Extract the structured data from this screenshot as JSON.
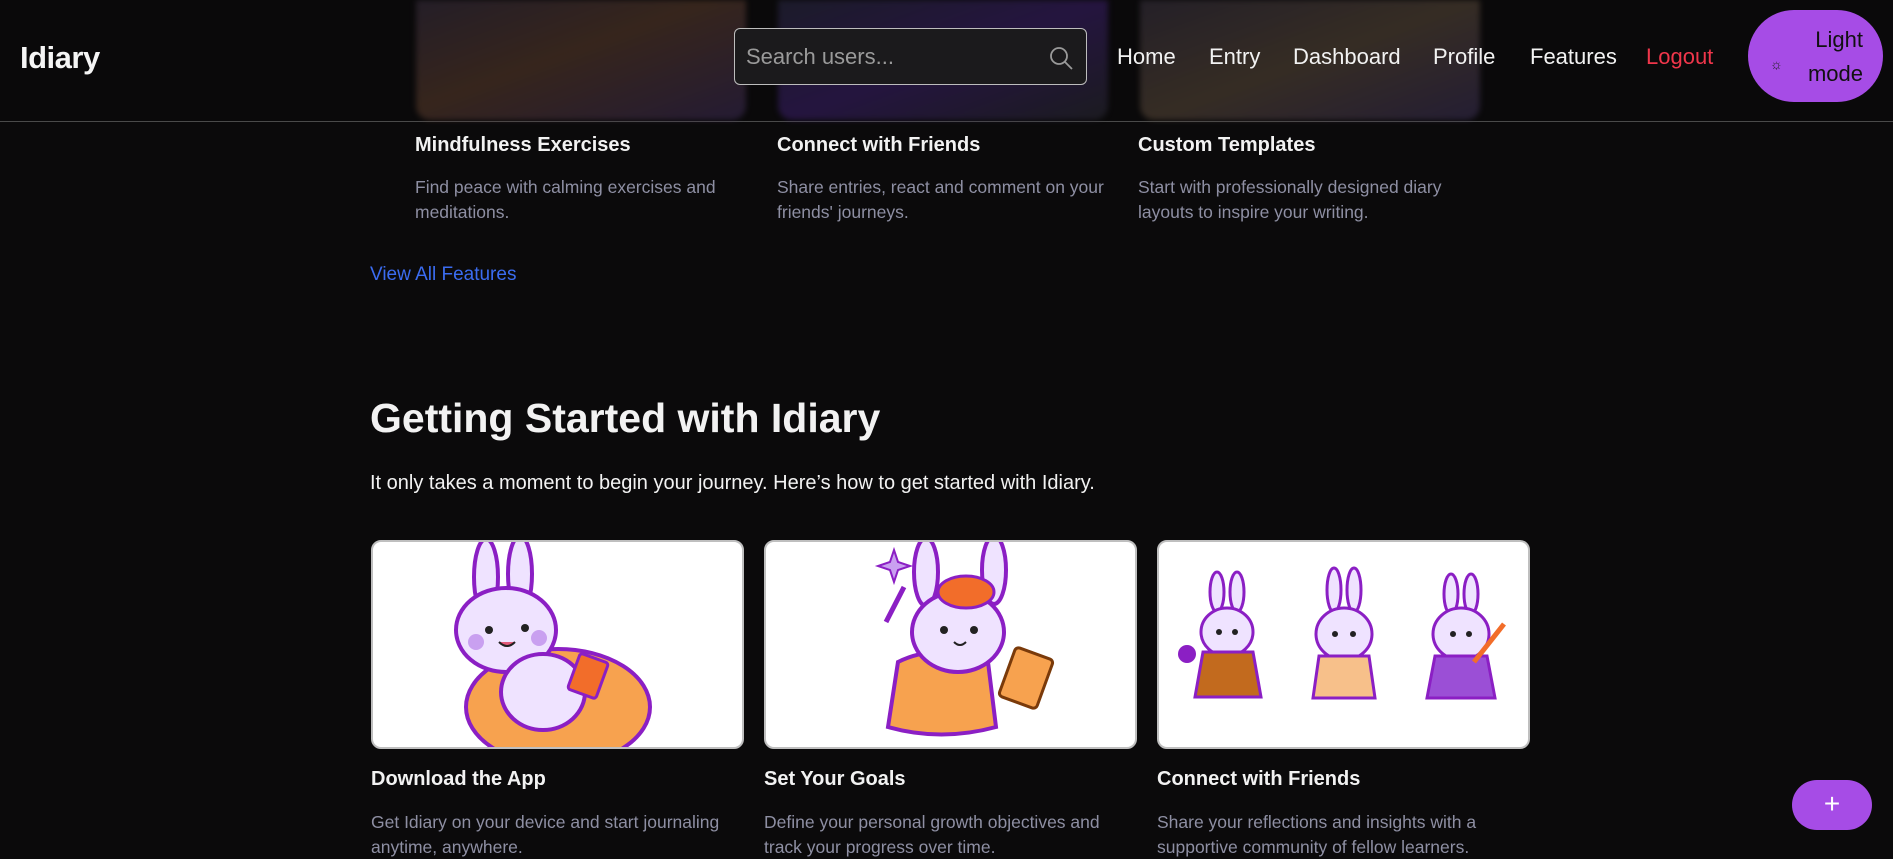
{
  "header": {
    "brand": "Idiary",
    "search_placeholder": "Search users...",
    "nav": [
      "Home",
      "Entry",
      "Dashboard",
      "Profile",
      "Features"
    ],
    "logout": "Logout",
    "mode_button": {
      "line1": "Light",
      "line2": "mode"
    }
  },
  "features": [
    {
      "title": "Mindfulness Exercises",
      "desc": "Find peace with calming exercises and meditations."
    },
    {
      "title": "Connect with Friends",
      "desc": "Share entries, react and comment on your friends' journeys."
    },
    {
      "title": "Custom Templates",
      "desc": "Start with professionally designed diary layouts to inspire your writing."
    }
  ],
  "view_all": "View All Features",
  "getting_started": {
    "heading": "Getting Started with Idiary",
    "lead": "It only takes a moment to begin your journey. Here’s how to get started with Idiary.",
    "steps": [
      {
        "title": "Download the App",
        "desc": "Get Idiary on your device and start journaling anytime, anywhere."
      },
      {
        "title": "Set Your Goals",
        "desc": "Define your personal growth objectives and track your progress over time."
      },
      {
        "title": "Connect with Friends",
        "desc": "Share your reflections and insights with a supportive community of fellow learners."
      }
    ]
  },
  "fab": "+",
  "colors": {
    "accent": "#a64ce6",
    "logout": "#f0364b",
    "link": "#3b6cf0",
    "muted": "#8e8fa3"
  }
}
